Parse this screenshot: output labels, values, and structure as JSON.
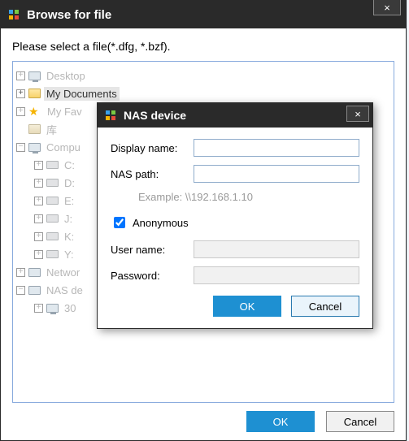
{
  "window": {
    "title": "Browse for file",
    "close_glyph": "×",
    "instruction": "Please select a file(*.dfg, *.bzf).",
    "ok_label": "OK",
    "cancel_label": "Cancel"
  },
  "tree": {
    "nodes": [
      {
        "label": "Desktop",
        "type": "monitor",
        "level": 0,
        "exp": "plus",
        "selected": false,
        "grey": true
      },
      {
        "label": "My Documents",
        "type": "folder",
        "level": 0,
        "exp": "plus",
        "selected": true,
        "grey": false
      },
      {
        "label": "My Fav",
        "type": "star",
        "level": 0,
        "exp": "plus",
        "selected": false,
        "grey": true
      },
      {
        "label": "库",
        "type": "folder",
        "level": 0,
        "exp": "none",
        "selected": false,
        "grey": true
      },
      {
        "label": "Compu",
        "type": "monitor",
        "level": 0,
        "exp": "minus",
        "selected": false,
        "grey": true
      },
      {
        "label": "C:",
        "type": "drive",
        "level": 1,
        "exp": "plus",
        "selected": false,
        "grey": true
      },
      {
        "label": "D:",
        "type": "drive",
        "level": 1,
        "exp": "plus",
        "selected": false,
        "grey": true
      },
      {
        "label": "E:",
        "type": "drive",
        "level": 1,
        "exp": "plus",
        "selected": false,
        "grey": true
      },
      {
        "label": "J:",
        "type": "drive",
        "level": 1,
        "exp": "plus",
        "selected": false,
        "grey": true
      },
      {
        "label": "K:",
        "type": "drive",
        "level": 1,
        "exp": "plus",
        "selected": false,
        "grey": true
      },
      {
        "label": "Y:",
        "type": "drive",
        "level": 1,
        "exp": "plus",
        "selected": false,
        "grey": true
      },
      {
        "label": "Networ",
        "type": "net",
        "level": 0,
        "exp": "plus",
        "selected": false,
        "grey": true
      },
      {
        "label": "NAS de",
        "type": "net",
        "level": 0,
        "exp": "minus",
        "selected": false,
        "grey": true
      },
      {
        "label": "30",
        "type": "monitor",
        "level": 1,
        "exp": "plus",
        "selected": false,
        "grey": true
      }
    ]
  },
  "modal": {
    "title": "NAS device",
    "close_glyph": "×",
    "display_name_label": "Display name:",
    "display_name_value": "",
    "nas_path_label": "NAS path:",
    "nas_path_value": "",
    "example_text": "Example: \\\\192.168.1.10",
    "anonymous_label": "Anonymous",
    "anonymous_checked": true,
    "username_label": "User name:",
    "username_value": "",
    "password_label": "Password:",
    "password_value": "",
    "ok_label": "OK",
    "cancel_label": "Cancel"
  }
}
